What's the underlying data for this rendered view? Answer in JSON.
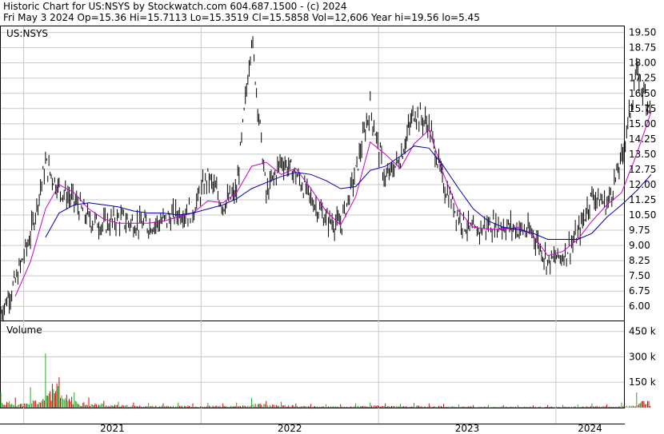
{
  "header": {
    "line1": "Historic Chart for US:NSYS by Stockwatch.com 604.687.1500 - (c) 2024",
    "line2": "Fri May  3 2024   Op=15.36   Hi=15.7113   Lo=15.3519   Cl=15.5858   Vol=12,606   Year hi=19.56   lo=5.45"
  },
  "price_panel": {
    "symbol_label": "US:NSYS"
  },
  "volume_panel": {
    "label": "Volume"
  },
  "colors": {
    "price_bars": "#000000",
    "ma_short": "#cc00cc",
    "ma_long": "#0000aa",
    "volume_up": "#22aa22",
    "volume_down": "#dd0000",
    "grid": "#c8c8c8"
  },
  "chart_data": [
    {
      "type": "line",
      "title": "US:NSYS",
      "x_tick_labels": [
        "2021",
        "2022",
        "2023",
        "2024"
      ],
      "y_tick_labels": [
        "6.00",
        "6.75",
        "7.50",
        "8.25",
        "9.00",
        "9.75",
        "10.50",
        "11.25",
        "12.00",
        "12.75",
        "13.50",
        "14.25",
        "15.00",
        "15.75",
        "16.50",
        "17.25",
        "18.00",
        "18.75",
        "19.50"
      ],
      "ylim": [
        5.3,
        19.8
      ],
      "grid": true,
      "series": [
        {
          "style": "ohlc-bars",
          "points": [
            [
              "2020-11",
              5.7
            ],
            [
              "2020-12",
              7.2
            ],
            [
              "2021-01",
              9.5
            ],
            [
              "2021-02",
              13.0
            ],
            [
              "2021-03",
              11.8
            ],
            [
              "2021-04",
              11.2
            ],
            [
              "2021-05",
              10.3
            ],
            [
              "2021-06",
              10.0
            ],
            [
              "2021-07",
              10.3
            ],
            [
              "2021-08",
              10.1
            ],
            [
              "2021-09",
              10.0
            ],
            [
              "2021-10",
              10.2
            ],
            [
              "2021-11",
              10.6
            ],
            [
              "2021-12",
              10.7
            ],
            [
              "2022-01",
              12.4
            ],
            [
              "2022-02",
              11.0
            ],
            [
              "2022-03",
              11.6
            ],
            [
              "2022-04",
              19.3
            ],
            [
              "2022-05",
              11.5
            ],
            [
              "2022-06",
              13.2
            ],
            [
              "2022-07",
              12.5
            ],
            [
              "2022-08",
              11.3
            ],
            [
              "2022-09",
              10.3
            ],
            [
              "2022-10",
              10.0
            ],
            [
              "2022-11",
              12.6
            ],
            [
              "2022-12",
              15.8
            ],
            [
              "2023-01",
              12.2
            ],
            [
              "2023-02",
              13.3
            ],
            [
              "2023-03",
              15.6
            ],
            [
              "2023-04",
              14.9
            ],
            [
              "2023-05",
              12.0
            ],
            [
              "2023-06",
              10.4
            ],
            [
              "2023-07",
              9.6
            ],
            [
              "2023-08",
              10.0
            ],
            [
              "2023-09",
              10.0
            ],
            [
              "2023-10",
              9.8
            ],
            [
              "2023-11",
              9.6
            ],
            [
              "2023-12",
              8.2
            ],
            [
              "2024-01",
              8.5
            ],
            [
              "2024-02",
              9.5
            ],
            [
              "2024-03",
              11.5
            ],
            [
              "2024-04",
              11.0
            ],
            [
              "2024-05",
              13.2
            ],
            [
              "2024-06",
              17.5
            ],
            [
              "2024-07",
              15.6
            ]
          ]
        },
        {
          "style": "moving-average-short",
          "points": [
            [
              "2020-12",
              6.5
            ],
            [
              "2021-01",
              8.2
            ],
            [
              "2021-02",
              10.8
            ],
            [
              "2021-03",
              12.0
            ],
            [
              "2021-04",
              11.6
            ],
            [
              "2021-05",
              10.8
            ],
            [
              "2021-06",
              10.3
            ],
            [
              "2021-07",
              10.1
            ],
            [
              "2021-08",
              10.1
            ],
            [
              "2021-09",
              10.1
            ],
            [
              "2021-10",
              10.2
            ],
            [
              "2021-11",
              10.4
            ],
            [
              "2021-12",
              10.6
            ],
            [
              "2022-01",
              11.2
            ],
            [
              "2022-02",
              11.1
            ],
            [
              "2022-03",
              11.6
            ],
            [
              "2022-04",
              12.9
            ],
            [
              "2022-05",
              13.1
            ],
            [
              "2022-06",
              12.5
            ],
            [
              "2022-07",
              12.8
            ],
            [
              "2022-08",
              11.8
            ],
            [
              "2022-09",
              10.7
            ],
            [
              "2022-10",
              10.0
            ],
            [
              "2022-11",
              11.4
            ],
            [
              "2022-12",
              14.1
            ],
            [
              "2023-01",
              13.5
            ],
            [
              "2023-02",
              12.8
            ],
            [
              "2023-03",
              14.0
            ],
            [
              "2023-04",
              14.7
            ],
            [
              "2023-05",
              12.5
            ],
            [
              "2023-06",
              10.7
            ],
            [
              "2023-07",
              9.9
            ],
            [
              "2023-08",
              9.8
            ],
            [
              "2023-09",
              9.8
            ],
            [
              "2023-10",
              9.9
            ],
            [
              "2023-11",
              9.5
            ],
            [
              "2023-12",
              8.5
            ],
            [
              "2024-01",
              8.7
            ],
            [
              "2024-02",
              9.3
            ],
            [
              "2024-03",
              10.2
            ],
            [
              "2024-04",
              11.0
            ],
            [
              "2024-05",
              11.6
            ],
            [
              "2024-06",
              13.5
            ],
            [
              "2024-07",
              15.6
            ]
          ]
        },
        {
          "style": "moving-average-long",
          "points": [
            [
              "2021-02",
              9.4
            ],
            [
              "2021-03",
              10.6
            ],
            [
              "2021-04",
              11.0
            ],
            [
              "2021-05",
              11.1
            ],
            [
              "2021-06",
              11.0
            ],
            [
              "2021-07",
              10.9
            ],
            [
              "2021-08",
              10.7
            ],
            [
              "2021-09",
              10.6
            ],
            [
              "2021-10",
              10.6
            ],
            [
              "2021-11",
              10.5
            ],
            [
              "2021-12",
              10.6
            ],
            [
              "2022-01",
              10.8
            ],
            [
              "2022-02",
              11.0
            ],
            [
              "2022-03",
              11.3
            ],
            [
              "2022-04",
              11.8
            ],
            [
              "2022-05",
              12.1
            ],
            [
              "2022-06",
              12.4
            ],
            [
              "2022-07",
              12.6
            ],
            [
              "2022-08",
              12.5
            ],
            [
              "2022-09",
              12.2
            ],
            [
              "2022-10",
              11.8
            ],
            [
              "2022-11",
              11.9
            ],
            [
              "2022-12",
              12.7
            ],
            [
              "2023-01",
              12.9
            ],
            [
              "2023-02",
              13.4
            ],
            [
              "2023-03",
              13.9
            ],
            [
              "2023-04",
              13.8
            ],
            [
              "2023-05",
              12.9
            ],
            [
              "2023-06",
              11.8
            ],
            [
              "2023-07",
              10.8
            ],
            [
              "2023-08",
              10.2
            ],
            [
              "2023-09",
              9.9
            ],
            [
              "2023-10",
              9.8
            ],
            [
              "2023-11",
              9.6
            ],
            [
              "2023-12",
              9.3
            ],
            [
              "2024-01",
              9.3
            ],
            [
              "2024-02",
              9.3
            ],
            [
              "2024-03",
              9.6
            ],
            [
              "2024-04",
              10.4
            ],
            [
              "2024-05",
              11.0
            ],
            [
              "2024-06",
              11.7
            ],
            [
              "2024-07",
              12.5
            ]
          ]
        }
      ]
    },
    {
      "type": "bar",
      "title": "Volume",
      "y_tick_labels": [
        "150 k",
        "300 k",
        "450 k"
      ],
      "ylim": [
        0,
        510000
      ],
      "x_tick_labels": [
        "2021",
        "2022",
        "2023",
        "2024"
      ],
      "grid": true,
      "volumes": [
        [
          "2020-11",
          90000,
          "up"
        ],
        [
          "2020-12",
          60000,
          "down"
        ],
        [
          "2021-01",
          120000,
          "up"
        ],
        [
          "2021-02",
          320000,
          "up"
        ],
        [
          "2021-03",
          180000,
          "down"
        ],
        [
          "2021-04",
          90000,
          "up"
        ],
        [
          "2021-05",
          60000,
          "down"
        ],
        [
          "2021-06",
          40000,
          "down"
        ],
        [
          "2021-07",
          35000,
          "up"
        ],
        [
          "2021-08",
          30000,
          "down"
        ],
        [
          "2021-09",
          28000,
          "up"
        ],
        [
          "2021-10",
          25000,
          "down"
        ],
        [
          "2021-11",
          30000,
          "up"
        ],
        [
          "2021-12",
          25000,
          "down"
        ],
        [
          "2022-01",
          28000,
          "up"
        ],
        [
          "2022-02",
          25000,
          "down"
        ],
        [
          "2022-03",
          30000,
          "up"
        ],
        [
          "2022-04",
          55000,
          "up"
        ],
        [
          "2022-05",
          40000,
          "down"
        ],
        [
          "2022-06",
          35000,
          "up"
        ],
        [
          "2022-07",
          25000,
          "down"
        ],
        [
          "2022-08",
          22000,
          "down"
        ],
        [
          "2022-09",
          20000,
          "up"
        ],
        [
          "2022-10",
          20000,
          "down"
        ],
        [
          "2022-11",
          25000,
          "up"
        ],
        [
          "2022-12",
          30000,
          "up"
        ],
        [
          "2023-01",
          25000,
          "down"
        ],
        [
          "2023-02",
          22000,
          "up"
        ],
        [
          "2023-03",
          28000,
          "up"
        ],
        [
          "2023-04",
          25000,
          "down"
        ],
        [
          "2023-05",
          22000,
          "down"
        ],
        [
          "2023-06",
          18000,
          "up"
        ],
        [
          "2023-07",
          15000,
          "down"
        ],
        [
          "2023-08",
          15000,
          "up"
        ],
        [
          "2023-09",
          14000,
          "down"
        ],
        [
          "2023-10",
          14000,
          "up"
        ],
        [
          "2023-11",
          14000,
          "down"
        ],
        [
          "2023-12",
          15000,
          "down"
        ],
        [
          "2024-01",
          16000,
          "up"
        ],
        [
          "2024-02",
          18000,
          "up"
        ],
        [
          "2024-03",
          25000,
          "up"
        ],
        [
          "2024-04",
          20000,
          "down"
        ],
        [
          "2024-05",
          30000,
          "up"
        ],
        [
          "2024-06",
          90000,
          "up"
        ],
        [
          "2024-07",
          40000,
          "up"
        ]
      ]
    }
  ]
}
